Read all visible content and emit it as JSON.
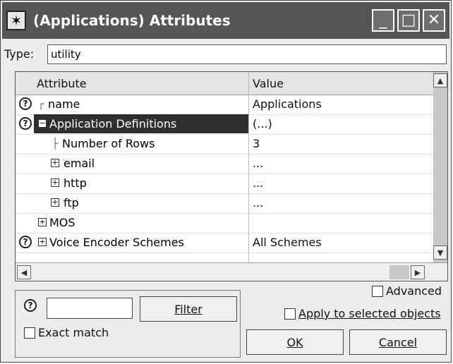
{
  "window": {
    "title": "(Applications) Attributes",
    "app_icon_glyph": "✶"
  },
  "titlebar_buttons": {
    "minimize": "_",
    "maximize": "□",
    "close": "✕"
  },
  "type": {
    "label": "Type:",
    "value": "utility"
  },
  "table": {
    "columns": [
      "Attribute",
      "Value"
    ],
    "rows": [
      {
        "attribute": "name",
        "value": "Applications",
        "help": true,
        "toggle": "",
        "level": 0
      },
      {
        "attribute": "Application Definitions",
        "value": "(...)",
        "help": true,
        "toggle": "⊟",
        "level": 0,
        "selected": true
      },
      {
        "attribute": "Number of Rows",
        "value": "3",
        "help": false,
        "toggle": "",
        "level": 1
      },
      {
        "attribute": "email",
        "value": "...",
        "help": false,
        "toggle": "⊞",
        "level": 1
      },
      {
        "attribute": "http",
        "value": "...",
        "help": false,
        "toggle": "⊞",
        "level": 1
      },
      {
        "attribute": "ftp",
        "value": "...",
        "help": false,
        "toggle": "⊞",
        "level": 1
      },
      {
        "attribute": "MOS",
        "value": "",
        "help": false,
        "toggle": "⊞",
        "level": 0
      },
      {
        "attribute": "Voice Encoder Schemes",
        "value": "All Schemes",
        "help": true,
        "toggle": "⊞",
        "level": 0
      }
    ]
  },
  "filter": {
    "help_glyph": "?",
    "input_value": "",
    "button_label": "Filter",
    "exact_match_label": "Exact match"
  },
  "options": {
    "advanced_label": "Advanced",
    "apply_label": "Apply to selected objects"
  },
  "actions": {
    "ok_label": "OK",
    "cancel_label": "Cancel"
  },
  "colors": {
    "titlebar": "#555555",
    "selected_row": "#2f2f2f",
    "window_bg": "#ececec"
  }
}
